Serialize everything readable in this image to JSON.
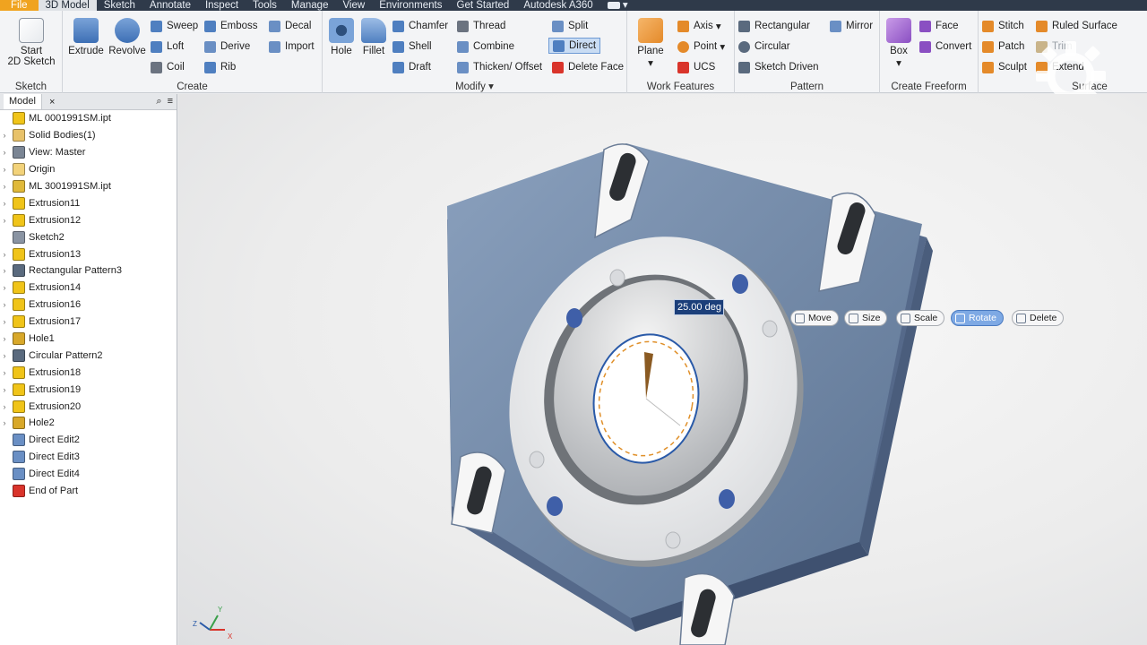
{
  "tabs": [
    {
      "label": "File",
      "kind": "file"
    },
    {
      "label": "3D Model",
      "kind": "active"
    },
    {
      "label": "Sketch"
    },
    {
      "label": "Annotate"
    },
    {
      "label": "Inspect"
    },
    {
      "label": "Tools"
    },
    {
      "label": "Manage"
    },
    {
      "label": "View"
    },
    {
      "label": "Environments"
    },
    {
      "label": "Get Started"
    },
    {
      "label": "Autodesk A360"
    }
  ],
  "ribbon": {
    "sketch": {
      "title": "Sketch",
      "start_sketch_line1": "Start",
      "start_sketch_line2": "2D Sketch"
    },
    "create": {
      "title": "Create",
      "extrude": "Extrude",
      "revolve": "Revolve",
      "sweep": "Sweep",
      "loft": "Loft",
      "coil": "Coil",
      "emboss": "Emboss",
      "derive": "Derive",
      "rib": "Rib",
      "decal": "Decal",
      "import": "Import"
    },
    "modify": {
      "title": "Modify",
      "hole": "Hole",
      "fillet": "Fillet",
      "chamfer": "Chamfer",
      "shell": "Shell",
      "draft": "Draft",
      "thread": "Thread",
      "combine": "Combine",
      "thicken": "Thicken/ Offset",
      "split": "Split",
      "direct": "Direct",
      "delete_face": "Delete Face"
    },
    "work": {
      "title": "Work Features",
      "plane": "Plane",
      "axis": "Axis",
      "point": "Point",
      "ucs": "UCS"
    },
    "pattern": {
      "title": "Pattern",
      "rectangular": "Rectangular",
      "circular": "Circular",
      "sketch_driven": "Sketch Driven",
      "mirror": "Mirror"
    },
    "freeform": {
      "title": "Create Freeform",
      "box": "Box",
      "face": "Face",
      "convert": "Convert"
    },
    "surface": {
      "title": "Surface",
      "stitch": "Stitch",
      "patch": "Patch",
      "sculpt": "Sculpt",
      "ruled": "Ruled Surface",
      "trim": "Trim",
      "extend": "Extend"
    }
  },
  "browser": {
    "tab_label": "Model",
    "close": "×",
    "items": [
      {
        "label": "ML 0001991SM.ipt",
        "icon": "part-icon",
        "exp": "",
        "color": "#f0c419"
      },
      {
        "label": "Solid Bodies(1)",
        "icon": "solid-bodies-icon",
        "exp": "›",
        "color": "#e8c26a"
      },
      {
        "label": "View: Master",
        "icon": "view-icon",
        "exp": "›",
        "color": "#7a8594"
      },
      {
        "label": "Origin",
        "icon": "folder-icon",
        "exp": "›",
        "color": "#f2d27a"
      },
      {
        "label": "ML 3001991SM.ipt",
        "icon": "derived-part-icon",
        "exp": "›",
        "color": "#e0b93a"
      },
      {
        "label": "Extrusion11",
        "icon": "extrusion-icon",
        "exp": "›",
        "color": "#f0c419"
      },
      {
        "label": "Extrusion12",
        "icon": "extrusion-icon",
        "exp": "›",
        "color": "#f0c419"
      },
      {
        "label": "Sketch2",
        "icon": "sketch-icon",
        "exp": "",
        "color": "#8a94a3"
      },
      {
        "label": "Extrusion13",
        "icon": "extrusion-icon",
        "exp": "›",
        "color": "#f0c419"
      },
      {
        "label": "Rectangular Pattern3",
        "icon": "rect-pattern-icon",
        "exp": "›",
        "color": "#5a6a7e"
      },
      {
        "label": "Extrusion14",
        "icon": "extrusion-icon",
        "exp": "›",
        "color": "#f0c419"
      },
      {
        "label": "Extrusion16",
        "icon": "extrusion-icon",
        "exp": "›",
        "color": "#f0c419"
      },
      {
        "label": "Extrusion17",
        "icon": "extrusion-icon",
        "exp": "›",
        "color": "#f0c419"
      },
      {
        "label": "Hole1",
        "icon": "hole-icon",
        "exp": "›",
        "color": "#d8a82a"
      },
      {
        "label": "Circular Pattern2",
        "icon": "circ-pattern-icon",
        "exp": "›",
        "color": "#5a6a7e"
      },
      {
        "label": "Extrusion18",
        "icon": "extrusion-icon",
        "exp": "›",
        "color": "#f0c419"
      },
      {
        "label": "Extrusion19",
        "icon": "extrusion-icon",
        "exp": "›",
        "color": "#f0c419"
      },
      {
        "label": "Extrusion20",
        "icon": "extrusion-icon",
        "exp": "›",
        "color": "#f0c419"
      },
      {
        "label": "Hole2",
        "icon": "hole-icon",
        "exp": "›",
        "color": "#d8a82a"
      },
      {
        "label": "Direct Edit2",
        "icon": "direct-edit-icon",
        "exp": "",
        "color": "#6a8fc4"
      },
      {
        "label": "Direct Edit3",
        "icon": "direct-edit-icon",
        "exp": "",
        "color": "#6a8fc4"
      },
      {
        "label": "Direct Edit4",
        "icon": "direct-edit-icon",
        "exp": "",
        "color": "#6a8fc4"
      },
      {
        "label": "End of Part",
        "icon": "end-of-part-icon",
        "exp": "",
        "color": "#d9342b"
      }
    ]
  },
  "viewport": {
    "angle_value": "25.00 deg",
    "mini_toolbar": {
      "move": "Move",
      "size": "Size",
      "scale": "Scale",
      "rotate": "Rotate",
      "delete": "Delete"
    },
    "triad": {
      "x": "X",
      "y": "Y",
      "z": "Z"
    }
  },
  "colors": {
    "accent_tab": "#f0a31f",
    "part_blue": "#6f87a6",
    "selection_blue": "#7ea9e4",
    "ribbon_bg": "#f3f4f6"
  }
}
